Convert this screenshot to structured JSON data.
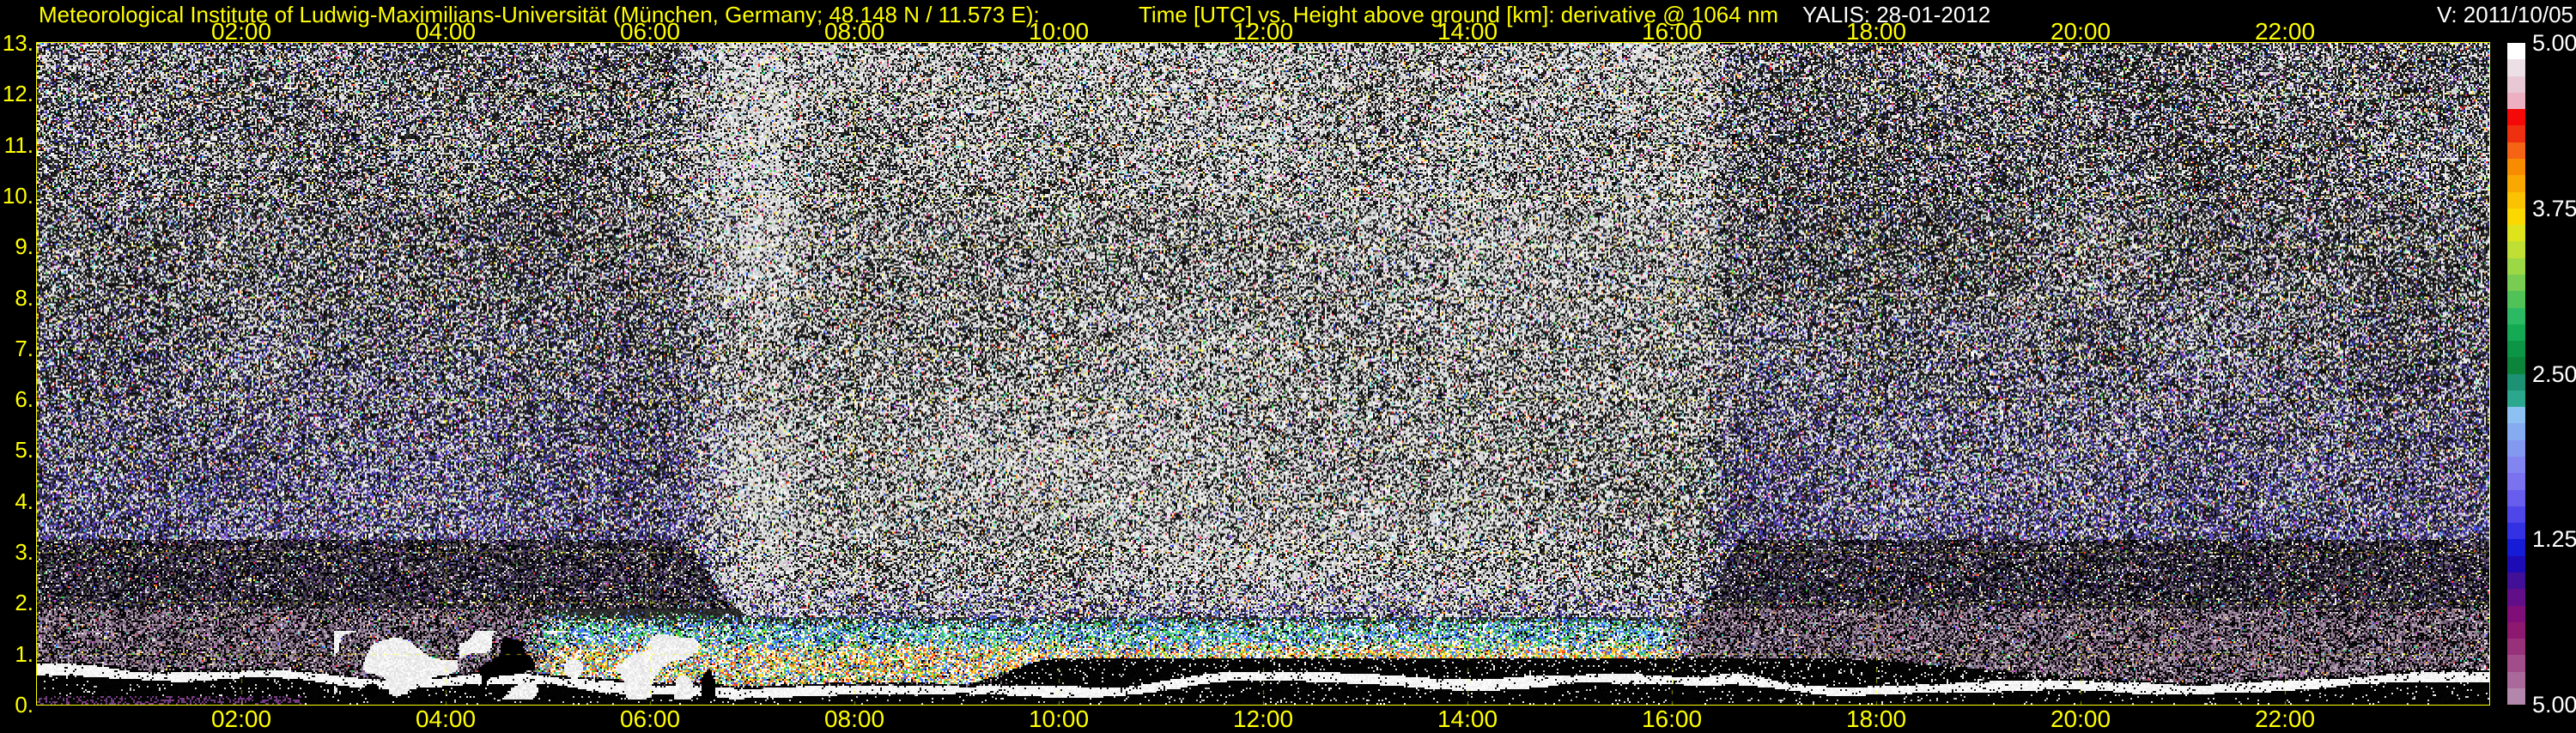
{
  "header": {
    "institute_title": "Meteorological Institute of Ludwig-Maximilians-Universität (München, Germany; 48.148 N / 11.573 E):",
    "plot_title": "Time [UTC] vs. Height above ground [km]: derivative @ 1064 nm",
    "instrument_date": "YALIS: 28-01-2012",
    "version_label": "V: 2011/10/05"
  },
  "colors": {
    "background": "#000000",
    "axis_text": "#ffff00",
    "grid": "#ffff00",
    "plot_border": "#ffff00",
    "meta_text": "#ffffff"
  },
  "chart_data": {
    "type": "heatmap",
    "title": "Time [UTC] vs. Height above ground [km]: derivative @ 1064 nm",
    "instrument": "YALIS",
    "date": "28-01-2012",
    "signal": "derivative @ 1064 nm",
    "x_axis": {
      "label": "Time [UTC]",
      "range_hours": [
        0,
        24
      ],
      "tick_hours": [
        2,
        4,
        6,
        8,
        10,
        12,
        14,
        16,
        18,
        20,
        22
      ],
      "tick_labels": [
        "02:00",
        "04:00",
        "06:00",
        "08:00",
        "10:00",
        "12:00",
        "14:00",
        "16:00",
        "18:00",
        "20:00",
        "22:00"
      ],
      "ticks_shown": "top and bottom",
      "grid": "dashed yellow line every 2 hours"
    },
    "y_axis": {
      "label": "Height above ground [km]",
      "range_km": [
        0,
        13
      ],
      "tick_km": [
        0,
        1,
        2,
        3,
        4,
        5,
        6,
        7,
        8,
        9,
        10,
        11,
        12,
        13
      ],
      "tick_labels": [
        "0.",
        "1.",
        "2.",
        "3.",
        "4.",
        "5.",
        "6.",
        "7.",
        "8.",
        "9.",
        "10.",
        "11.",
        "12.",
        "13."
      ],
      "grid": "dashed yellow line every 1 km"
    },
    "colorbar": {
      "tick_labels": [
        "5.00",
        "3.75",
        "2.50",
        "1.25",
        "5.00"
      ],
      "tick_fractions": [
        0,
        0.25,
        0.5,
        0.75,
        1
      ],
      "colors": [
        "#ffffff",
        "#ece0e6",
        "#e8c8d4",
        "#ecb0c0",
        "#f40808",
        "#ef3010",
        "#f46414",
        "#f88c00",
        "#f9a800",
        "#fac200",
        "#fbd800",
        "#dfe31c",
        "#bfdf34",
        "#9cd746",
        "#77cc51",
        "#50c257",
        "#2cb963",
        "#14a953",
        "#0b9544",
        "#0c843a",
        "#1d9173",
        "#2aa78d",
        "#8dc1f2",
        "#85acf1",
        "#8399f0",
        "#8285ef",
        "#7a72ee",
        "#685eed",
        "#4f46ea",
        "#3231e4",
        "#161bd6",
        "#1d0cb6",
        "#411097",
        "#620e89",
        "#7f0e79",
        "#8d186f",
        "#97317a",
        "#a04d8a",
        "#a96a9b",
        "#b287ab"
      ]
    },
    "features": [
      "Field dominated by black/white salt-and-pepper detector noise with sparse red/green/blue/yellow speckles",
      "Brighter (whiter) noise from ~07:00 to ~16:30 above ~2 km (daylight background)",
      "Blue/purple-tinted noise below ~6-8 km before ~06:00 and after ~16:30",
      "Purple band ~2-3.2 km and mauve/pink band ~0.4-1.9 km during night and evening hours",
      "Colourful aerosol band (white/yellow/orange/red/green/blue) at ~0.9-1.9 km from ~05:00 to ~16:00",
      "Bright white wavy boundary-layer echo near 0.3-0.8 km across the whole day over a black near-ground band",
      "White cloud blobs with black shadows between ~03:00 and ~06:45 below ~1.4 km"
    ]
  }
}
